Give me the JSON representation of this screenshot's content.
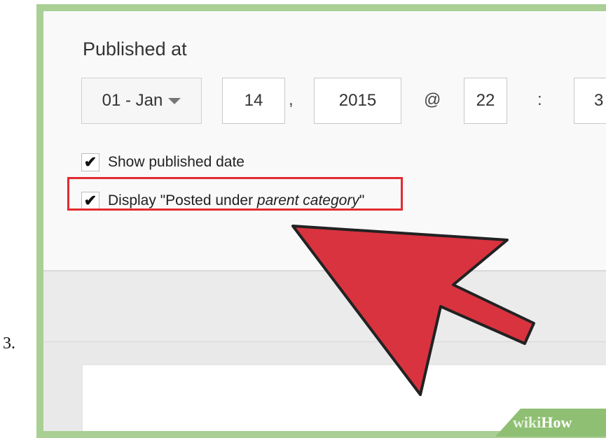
{
  "step": {
    "number": "3."
  },
  "publish": {
    "title": "Published at",
    "month_value": "01 - Jan",
    "day_value": "14",
    "day_separator": ",",
    "year_value": "2015",
    "at_symbol": "@",
    "hour_value": "22",
    "time_separator": ":",
    "minute_value_partial": "3"
  },
  "options": {
    "show_date": {
      "label": "Show published date",
      "checked": true
    },
    "posted_under": {
      "label_prefix": "Display \"Posted under ",
      "label_italic": "parent category",
      "label_suffix": "\"",
      "checked": true
    }
  },
  "watermark": {
    "brand_a": "wiki",
    "brand_b": "How"
  },
  "colors": {
    "highlight": "#e22a31",
    "arrow": "#d9333f",
    "frame": "#a9cf94"
  }
}
